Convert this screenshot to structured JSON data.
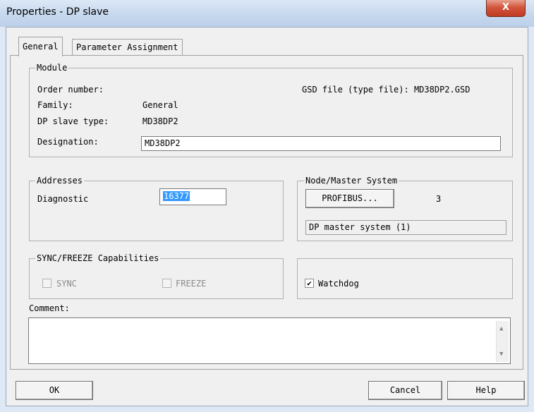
{
  "window": {
    "title": "Properties - DP slave",
    "close_label": "X"
  },
  "tabs": [
    {
      "label": "General"
    },
    {
      "label": "Parameter Assignment"
    }
  ],
  "module": {
    "group_title": "Module",
    "order_number_label": "Order number:",
    "gsd_label": "GSD file (type file): MD38DP2.GSD",
    "family_label": "Family:",
    "family_value": "General",
    "slave_type_label": "DP slave type:",
    "slave_type_value": "MD38DP2",
    "designation_label": "Designation:",
    "designation_value": "MD38DP2"
  },
  "addresses": {
    "group_title": "Addresses",
    "diagnostic_label": "Diagnostic",
    "diagnostic_value": "16377"
  },
  "node_master": {
    "group_title": "Node/Master System",
    "profibus_button": "PROFIBUS...",
    "node_number": "3",
    "master_system": "DP master system (1)"
  },
  "sync_freeze": {
    "group_title": "SYNC/FREEZE Capabilities",
    "sync_label": "SYNC",
    "freeze_label": "FREEZE",
    "sync_checked": false,
    "freeze_checked": false
  },
  "watchdog": {
    "label": "Watchdog",
    "checked": true,
    "check_glyph": "✔"
  },
  "comment": {
    "label": "Comment:",
    "value": ""
  },
  "buttons": {
    "ok": "OK",
    "cancel": "Cancel",
    "help": "Help"
  },
  "colors": {
    "selection": "#3399ff",
    "close": "#c7432b"
  }
}
